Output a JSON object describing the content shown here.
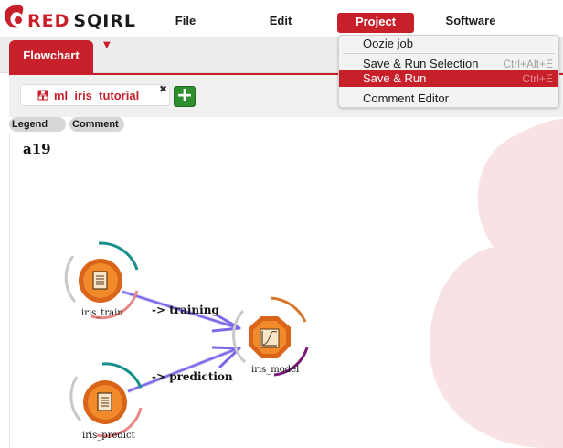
{
  "app": {
    "logo_prefix": "RED",
    "logo_suffix": "SQIRL"
  },
  "menu": {
    "items": [
      {
        "label": "File"
      },
      {
        "label": "Edit"
      },
      {
        "label": "Project",
        "active": true
      },
      {
        "label": "Software"
      }
    ]
  },
  "dropdown": {
    "items": [
      {
        "label": "Oozie job",
        "shortcut": ""
      },
      {
        "label": "Save & Run Selection",
        "shortcut": "Ctrl+Alt+E"
      },
      {
        "label": "Save & Run",
        "shortcut": "Ctrl+E",
        "highlighted": true
      },
      {
        "label": "Comment Editor",
        "shortcut": ""
      }
    ]
  },
  "tabs": {
    "main_tab": "Flowchart",
    "dropdown_arrow": "▼"
  },
  "workspace": {
    "file_tab": "ml_iris_tutorial",
    "close_glyph": "✖",
    "add_glyph": "+"
  },
  "toolbar": {
    "legend": "Legend",
    "comment": "Comment"
  },
  "canvas": {
    "title": "a19",
    "nodes": [
      {
        "id": "iris_train",
        "label": "iris_train",
        "kind": "source"
      },
      {
        "id": "iris_predict",
        "label": "iris_predict",
        "kind": "source"
      },
      {
        "id": "iris_model",
        "label": "iris_model",
        "kind": "model"
      }
    ],
    "links": [
      {
        "from": "iris_train",
        "to": "iris_model",
        "label": "-> training"
      },
      {
        "from": "iris_predict",
        "to": "iris_model",
        "label": "-> prediction"
      }
    ]
  },
  "colors": {
    "brand_red": "#c8202a",
    "node_orange": "#e8731a",
    "arrow_purple": "#7b68e8",
    "arc_teal": "#18908a",
    "arc_pink": "#e88888",
    "arc_purple": "#7a1a78",
    "arc_orange": "#d9782a",
    "add_green": "#2f8f2f"
  }
}
